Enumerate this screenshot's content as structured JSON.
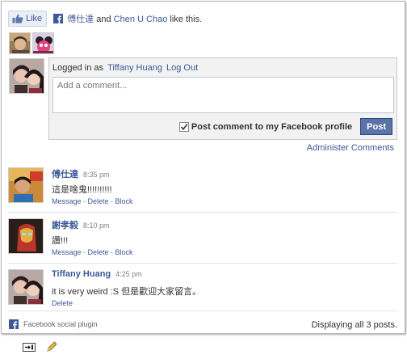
{
  "like_bar": {
    "like_label": "Like",
    "liker_1": "傅仕達",
    "conjunction": "and",
    "liker_2": "Chen U Chao",
    "suffix": "like this."
  },
  "compose": {
    "logged_in_prefix": "Logged in as",
    "user_name": "Tiffany Huang",
    "logout_label": "Log Out",
    "placeholder": "Add a comment...",
    "post_to_profile_label": "Post comment to my Facebook profile",
    "post_to_profile_checked": true,
    "post_button": "Post"
  },
  "administer_label": "Administer Comments",
  "comments": [
    {
      "name": "傅仕達",
      "time": "8:35 pm",
      "text": "這是啥鬼!!!!!!!!!!",
      "actions": [
        "Message",
        "Delete",
        "Block"
      ]
    },
    {
      "name": "謝孝毅",
      "time": "8:10 pm",
      "text": "讚!!!",
      "actions": [
        "Message",
        "Delete",
        "Block"
      ]
    },
    {
      "name": "Tiffany Huang",
      "time": "4:25 pm",
      "text": "it is very weird :S 但是歡迎大家留言。",
      "actions": [
        "Delete"
      ]
    }
  ],
  "footer": {
    "plugin_label": "Facebook social plugin",
    "count_label": "Displaying all 3 posts."
  },
  "colors": {
    "fb_blue": "#3b5998",
    "post_button": "#5b74a8"
  },
  "icons": [
    "thumbs-up-icon",
    "facebook-icon",
    "checkmark-icon",
    "insert-icon",
    "pencil-icon"
  ]
}
